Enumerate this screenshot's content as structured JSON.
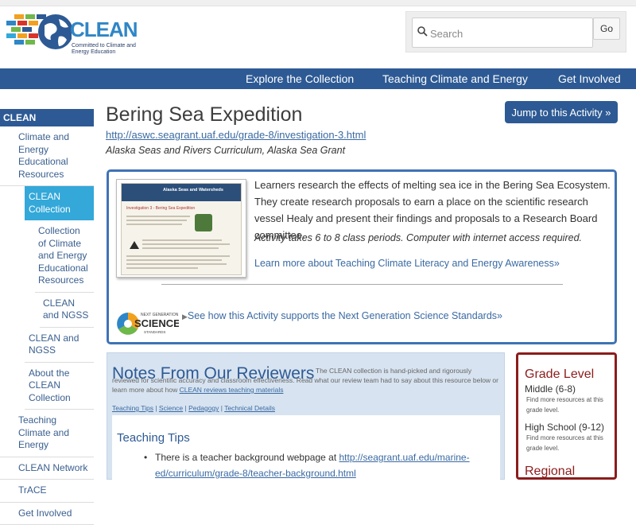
{
  "logo": {
    "name": "CLEAN",
    "tagline": "Committed to Climate and Energy Education"
  },
  "search": {
    "placeholder": "Search",
    "button": "Go"
  },
  "nav": [
    "Explore the Collection",
    "Teaching Climate and Energy",
    "Get Involved"
  ],
  "sidebar": {
    "header": "CLEAN",
    "items": [
      {
        "label": "Climate and Energy Educational Resources",
        "level": 1,
        "active": false
      },
      {
        "label": "CLEAN Collection",
        "level": 2,
        "active": true
      },
      {
        "label": "Collection of Climate and Energy Educational Resources",
        "level": 3,
        "active": false
      },
      {
        "label": "CLEAN and NGSS",
        "level": 4,
        "active": false
      },
      {
        "label": "CLEAN and NGSS",
        "level": 2,
        "active": false
      },
      {
        "label": "About the CLEAN Collection",
        "level": 2,
        "active": false
      },
      {
        "label": "Teaching Climate and Energy",
        "level": 1,
        "active": false
      },
      {
        "label": "CLEAN Network",
        "level": 1,
        "active": false
      },
      {
        "label": "TrACE",
        "level": 1,
        "active": false
      },
      {
        "label": "Get Involved",
        "level": 1,
        "active": false
      }
    ]
  },
  "page": {
    "title": "Bering Sea Expedition",
    "jump_button": "Jump to this Activity »",
    "url": "http://aswc.seagrant.uaf.edu/grade-8/investigation-3.html",
    "source": "Alaska Seas and Rivers Curriculum, Alaska Sea Grant"
  },
  "activity": {
    "thumbnail_heading": "Alaska Seas and Watersheds",
    "thumbnail_subheading": "Investigation 3 - Bering Sea Expedition",
    "description": "Learners research the effects of melting sea ice in the Bering Sea Ecosystem. They create research proposals to earn a place on the scientific research vessel Healy and present their findings and proposals to a Research Board committee.",
    "periods": "Activity takes 6 to 8 class periods. Computer with internet access required.",
    "learn_more": "Learn more about Teaching Climate Literacy and Energy Awareness»",
    "ngss_logo_top": "NEXT GENERATION",
    "ngss_logo_main": "SCIENCE",
    "ngss_logo_bottom": "STANDARDS",
    "ngss_link": "See how this Activity supports the Next Generation Science Standards»"
  },
  "reviewers": {
    "title": "Notes From Our Reviewers",
    "blurb": "The CLEAN collection is hand-picked and rigorously reviewed for scientific accuracy and classroom effectiveness. Read what our review team had to say about this resource below or learn more about how",
    "blurb_link": "CLEAN reviews teaching materials",
    "tabs": [
      "Teaching Tips",
      "Science",
      "Pedagogy",
      "Technical Details"
    ],
    "tips_heading": "Teaching Tips",
    "tip1_text": "There is a teacher background webpage at",
    "tip1_link": "http://seagrant.uaf.edu/marine-",
    "tip1_link_cont": "ed/curriculum/grade-8/teacher-background.html"
  },
  "grade": {
    "title": "Grade Level",
    "levels": [
      {
        "name": "Middle (6-8)",
        "note": "Find more resources at this grade level."
      },
      {
        "name": "High School (9-12)",
        "note": "Find more resources at this grade level."
      }
    ],
    "region_title": "Regional"
  },
  "colors": {
    "nav_blue": "#2d5a94",
    "active_cyan": "#34a8d9",
    "grade_red": "#8c1c1c",
    "reviewer_bg": "#d7e3f0"
  }
}
